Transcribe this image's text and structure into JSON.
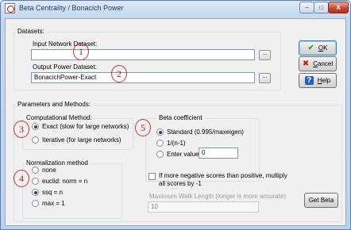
{
  "window": {
    "title": "Beta Centrality / Bonacich Power",
    "minimize_glyph": "–",
    "maximize_glyph": "□",
    "close_glyph": "X"
  },
  "datasets": {
    "group_label": "Datasets:",
    "input_label": "Input Network Dataset:",
    "input_value": "",
    "output_label": "Output Power Dataset:",
    "output_value": "BonacichPower-Exact",
    "browse_label": "..."
  },
  "params": {
    "group_label": "Parameters and Methods:",
    "computational": {
      "label": "Computational Method:",
      "options": [
        "Exact (slow for large networks)",
        "Iterative (for large networks)"
      ],
      "selected_index": 0
    },
    "normalization": {
      "label": "Normalization method",
      "options": [
        "none",
        "euclid: norm = n",
        "ssq = n",
        "max = 1"
      ],
      "selected_index": 2
    },
    "beta": {
      "label": "Beta coefficient",
      "options": [
        "Standard (0.995/maxeigen)",
        "1/(n-1)",
        "Enter value:"
      ],
      "selected_index": 0,
      "enter_value": "0"
    },
    "negate_label_line1": "If more negative scores than positive, multiply",
    "negate_label_line2": "all scores by -1",
    "negate_checked": false,
    "max_walk_label": "Maximum Walk Length (longer is more accurate)",
    "max_walk_value": "10"
  },
  "buttons": {
    "ok": "OK",
    "cancel": "Cancel",
    "help": "Help",
    "get_beta": "Get Beta",
    "ok_icon": "checkmark-icon",
    "cancel_icon": "x-icon",
    "help_icon": "question-icon"
  },
  "annotations": [
    "1",
    "2",
    "3",
    "4",
    "5"
  ],
  "colors": {
    "annotation": "#c8302a",
    "title_bar": "#c4d7ee",
    "dialog_bg": "#f0f0f0"
  }
}
